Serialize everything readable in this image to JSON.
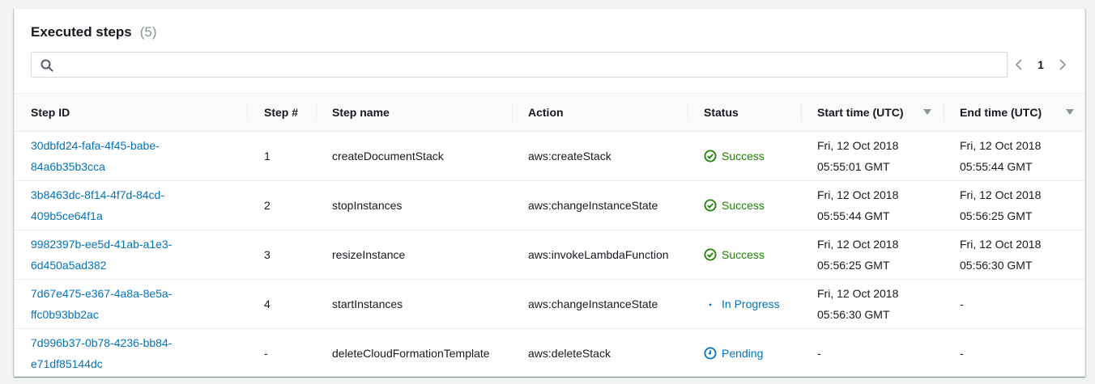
{
  "panel": {
    "title": "Executed steps",
    "count": "(5)"
  },
  "search": {
    "value": "",
    "placeholder": ""
  },
  "pagination": {
    "current_page": "1"
  },
  "colors": {
    "link": "#0073bb",
    "success": "#1d8102",
    "info": "#0073bb"
  },
  "table": {
    "headers": {
      "step_id": "Step ID",
      "step_num": "Step #",
      "step_name": "Step name",
      "action": "Action",
      "status": "Status",
      "start_time": "Start time (UTC)",
      "end_time": "End time (UTC)"
    },
    "rows": [
      {
        "id_line1": "30dbfd24-fafa-4f45-babe-",
        "id_line2": "84a6b35b3cca",
        "num": "1",
        "name": "createDocumentStack",
        "action": "aws:createStack",
        "status": "Success",
        "status_icon": "check-circle-icon",
        "start_line1": "Fri, 12 Oct 2018",
        "start_line2": "05:55:01 GMT",
        "end_line1": "Fri, 12 Oct 2018",
        "end_line2": "05:55:44 GMT"
      },
      {
        "id_line1": "3b8463dc-8f14-4f7d-84cd-",
        "id_line2": "409b5ce64f1a",
        "num": "2",
        "name": "stopInstances",
        "action": "aws:changeInstanceState",
        "status": "Success",
        "status_icon": "check-circle-icon",
        "start_line1": "Fri, 12 Oct 2018",
        "start_line2": "05:55:44 GMT",
        "end_line1": "Fri, 12 Oct 2018",
        "end_line2": "05:56:25 GMT"
      },
      {
        "id_line1": "9982397b-ee5d-41ab-a1e3-",
        "id_line2": "6d450a5ad382",
        "num": "3",
        "name": "resizeInstance",
        "action": "aws:invokeLambdaFunction",
        "status": "Success",
        "status_icon": "check-circle-icon",
        "start_line1": "Fri, 12 Oct 2018",
        "start_line2": "05:56:25 GMT",
        "end_line1": "Fri, 12 Oct 2018",
        "end_line2": "05:56:30 GMT"
      },
      {
        "id_line1": "7d67e475-e367-4a8a-8e5a-",
        "id_line2": "ffc0b93bb2ac",
        "num": "4",
        "name": "startInstances",
        "action": "aws:changeInstanceState",
        "status": "In Progress",
        "status_icon": "spinner-icon",
        "start_line1": "Fri, 12 Oct 2018",
        "start_line2": "05:56:30 GMT",
        "end_line1": "-",
        "end_line2": ""
      },
      {
        "id_line1": "7d996b37-0b78-4236-bb84-",
        "id_line2": "e71df85144dc",
        "num": "-",
        "name": "deleteCloudFormationTemplate",
        "action": "aws:deleteStack",
        "status": "Pending",
        "status_icon": "clock-icon",
        "start_line1": "-",
        "start_line2": "",
        "end_line1": "-",
        "end_line2": ""
      }
    ]
  }
}
